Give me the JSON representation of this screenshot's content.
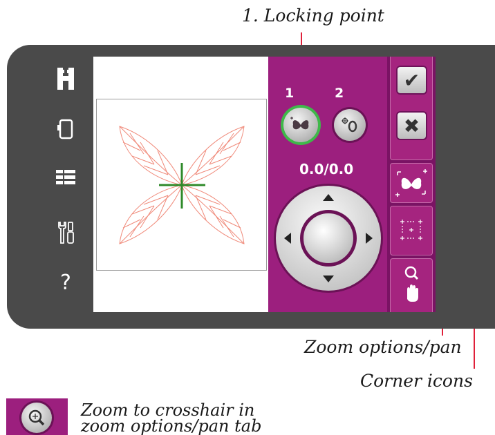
{
  "callouts": {
    "locking_point": "1. Locking point",
    "zoom_options_pan": "Zoom options/pan",
    "corner_icons": "Corner icons",
    "zoom_crosshair_line1": "Zoom to crosshair in",
    "zoom_crosshair_line2": "zoom options/pan tab"
  },
  "sidebar": {
    "items": [
      {
        "icon": "embroidery-mode-icon",
        "glyph": "H"
      },
      {
        "icon": "hoop-icon",
        "glyph": ""
      },
      {
        "icon": "stitch-menu-icon",
        "glyph": ""
      },
      {
        "icon": "tools-icon",
        "glyph": ""
      },
      {
        "icon": "help-icon",
        "glyph": "?"
      }
    ]
  },
  "locking_points": [
    {
      "number": "1",
      "selected": true
    },
    {
      "number": "2",
      "selected": false
    }
  ],
  "position_readout": "0.0/0.0",
  "right_buttons": {
    "confirm": "✔",
    "cancel": "✖"
  },
  "colors": {
    "panel_magenta": "#9c1f7e",
    "strip_magenta": "#7a1364",
    "device_gray": "#4a4a4a",
    "selected_ring": "#3fb84a",
    "leader_line": "#e0203a",
    "design_outline": "#f08a7a",
    "crosshair": "#2f8a2a"
  }
}
